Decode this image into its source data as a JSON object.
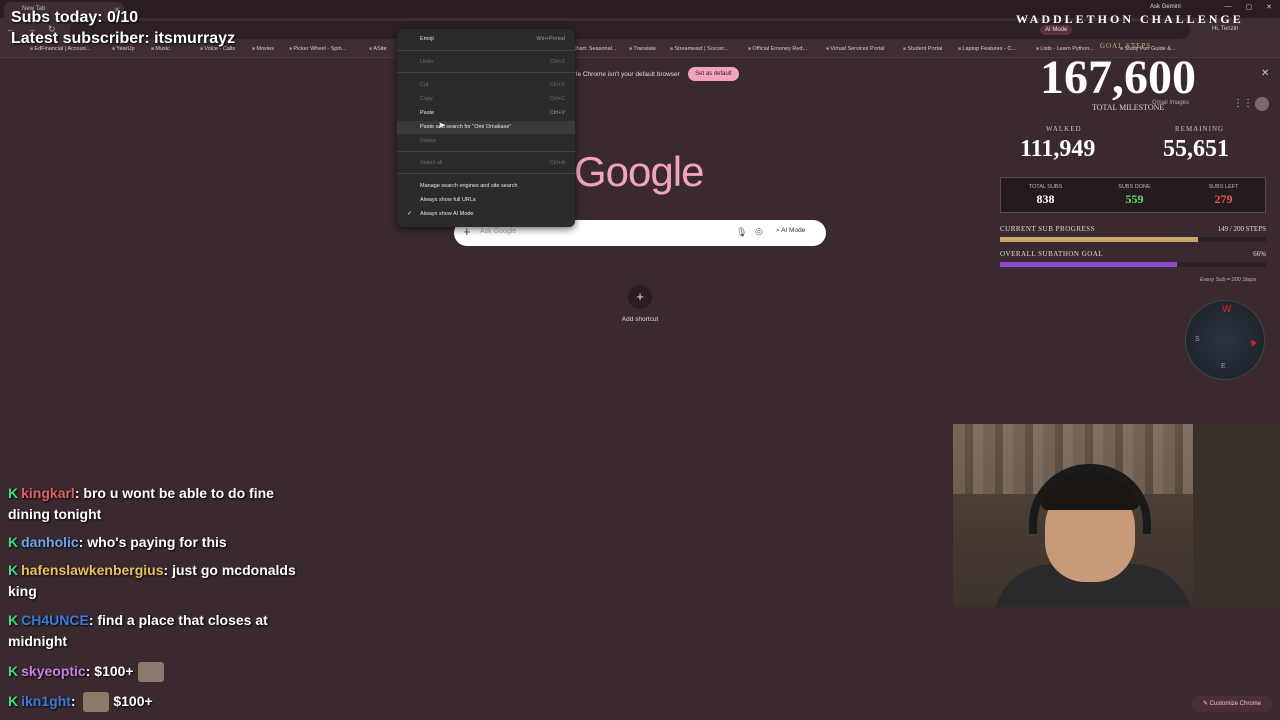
{
  "browser": {
    "tab_title": "New Tab",
    "ask_gemini": "Ask Gemini",
    "ai_mode_pill": "AI Mode",
    "hi_user": "Hi, Tenzin",
    "bookmarks": [
      "EdFinancial | Accoun...",
      "YearUp",
      "Music",
      "Voice - Calls",
      "Movies",
      "Picker Wheel - Spin...",
      "ASite",
      "Chart: Seasonal...",
      "Translate",
      "Streameast | Soccer...",
      "Official Emoney Red...",
      "Virtual Services Portal",
      "Student Portal",
      "Laptop Features - C...",
      "Lists - Learn Python...",
      "Study Fun Guide &..."
    ],
    "infobar_text": "le Chrome isn't your default browser",
    "set_default_label": "Set as default",
    "gmail_links": "Gmail   Images"
  },
  "ntp": {
    "logo": "Google",
    "search_placeholder": "Ask Google",
    "ai_mode_label": "AI Mode",
    "add_shortcut_label": "Add shortcut",
    "customize_label": "Customize Chrome"
  },
  "context_menu": {
    "items": [
      {
        "label": "Emoji",
        "shortcut": "Win+Period"
      },
      {
        "label": "Undo",
        "shortcut": "Ctrl+Z"
      },
      {
        "label": "Cut",
        "shortcut": "Ctrl+X"
      },
      {
        "label": "Copy",
        "shortcut": "Ctrl+C"
      },
      {
        "label": "Paste",
        "shortcut": "Ctrl+V"
      },
      {
        "label": "Paste and search for \"Omi Omakase\"",
        "shortcut": ""
      },
      {
        "label": "Delete",
        "shortcut": ""
      },
      {
        "label": "Select all",
        "shortcut": "Ctrl+A"
      },
      {
        "label": "Manage search engines and site search",
        "shortcut": ""
      },
      {
        "label": "Always show full URLs",
        "shortcut": ""
      },
      {
        "label": "Always show AI Mode",
        "shortcut": ""
      }
    ]
  },
  "overlay": {
    "subs_today": "Subs today: 0/10",
    "latest_subscriber": "Latest subscriber: itsmurrayz",
    "challenge_title": "WADDLETHON CHALLENGE",
    "goal_steps_label": "GOAL STEPS",
    "goal_steps_value": "167,600",
    "total_milestone": "TOTAL MILESTONE",
    "walked_label": "WALKED",
    "walked_value": "111,949",
    "remaining_label": "REMAINING",
    "remaining_value": "55,651",
    "total_subs_label": "TOTAL SUBS",
    "total_subs_value": "838",
    "subs_done_label": "SUBS DONE",
    "subs_done_value": "559",
    "subs_left_label": "SUBS LEFT",
    "subs_left_value": "279",
    "current_progress_label": "CURRENT SUB PROGRESS",
    "current_progress_value": "149 / 200 STEPS",
    "current_progress_fraction": 0.745,
    "overall_goal_label": "OVERALL SUBATHON GOAL",
    "overall_goal_value": "66%",
    "overall_goal_fraction": 0.667,
    "every_sub_note": "Every Sub = 200 Steps",
    "compass": {
      "n": "W",
      "s": "S",
      "e": "E"
    },
    "colors": {
      "subs_done": "#5ee05e",
      "subs_left": "#e05a5a",
      "current_bar": "#c8a86a",
      "overall_bar": "#8a4ccf"
    }
  },
  "chat": [
    {
      "user": "kingkarl",
      "user_color": "#e06060",
      "text": "bro u wont be able to do fine dining tonight"
    },
    {
      "user": "danholic",
      "user_color": "#6aa8f0",
      "text": "who's paying for this"
    },
    {
      "user": "hafenslawkenbergius",
      "user_color": "#e8c060",
      "text": "just go mcdonalds king"
    },
    {
      "user": "CH4UNCE",
      "user_color": "#3a7ad8",
      "text": "find a place that closes at midnight"
    },
    {
      "user": "skyeoptic",
      "user_color": "#c880e8",
      "text": "$100+"
    },
    {
      "user": "ikn1ght",
      "user_color": "#3a7ad8",
      "text": "$100+"
    }
  ]
}
